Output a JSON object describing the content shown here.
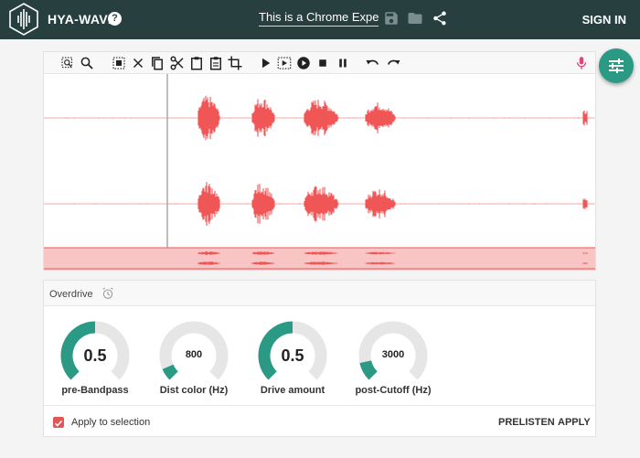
{
  "app": {
    "name": "HYA-WAVE",
    "help": "?",
    "title_value": "This is a Chrome Experi",
    "signin": "SIGN IN"
  },
  "colors": {
    "header": "#27403f",
    "accent": "#2a9a85",
    "wave": "#f05656",
    "mic": "#e0457b"
  },
  "toolbar": {
    "icons": [
      "zoom-selection-icon",
      "zoom-icon",
      "select-all-icon",
      "close-icon",
      "copy-icon",
      "cut-icon",
      "paste-icon",
      "paste-into-icon",
      "crop-icon",
      "play-icon",
      "play-selection-icon",
      "record-icon",
      "stop-icon",
      "pause-icon",
      "undo-icon",
      "redo-icon",
      "mic-icon"
    ]
  },
  "panel": {
    "title": "Overdrive",
    "knobs": [
      {
        "value": "0.5",
        "level": 0.5,
        "label": "pre-Bandpass"
      },
      {
        "value": "800",
        "level": 0.08,
        "label": "Dist color (Hz)"
      },
      {
        "value": "0.5",
        "level": 0.5,
        "label": "Drive amount"
      },
      {
        "value": "3000",
        "level": 0.12,
        "label": "post-Cutoff (Hz)"
      }
    ],
    "apply_to_selection": "Apply to selection",
    "prelisten": "PRELISTEN",
    "apply": "APPLY"
  }
}
